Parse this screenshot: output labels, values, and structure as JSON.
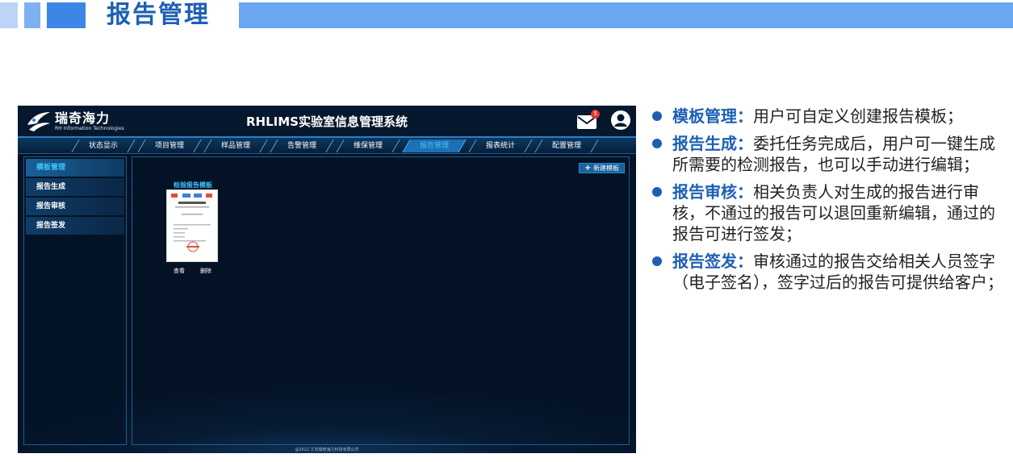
{
  "slide": {
    "title": "报告管理"
  },
  "app": {
    "logo": {
      "name_cn": "瑞奇海力",
      "name_en": "RH Information Technologies"
    },
    "title": "RHLIMS实验室信息管理系统",
    "mail_count": "5",
    "nav": [
      "状态显示",
      "项目管理",
      "样品管理",
      "告警管理",
      "维保管理",
      "报告管理",
      "报表统计",
      "配置管理"
    ],
    "nav_active": "报告管理",
    "sidebar": [
      "模板管理",
      "报告生成",
      "报告审核",
      "报告签发"
    ],
    "sidebar_active": "模板管理",
    "new_template_label": "新建模板",
    "template": {
      "title": "检验报告模板",
      "view_label": "查看",
      "delete_label": "删除"
    },
    "copyright": "@2022 江苏瑞奇海力科技有限公司"
  },
  "bullets": [
    {
      "term": "模板管理：",
      "text": "用户可自定义创建报告模板；"
    },
    {
      "term": "报告生成：",
      "text": "委托任务完成后，用户可一键生成所需要的检测报告，也可以手动进行编辑；"
    },
    {
      "term": "报告审核：",
      "text": "相关负责人对生成的报告进行审核，不通过的报告可以退回重新编辑，通过的报告可进行签发；"
    },
    {
      "term": "报告签发：",
      "text": "审核通过的报告交给相关人员签字（电子签名），签字过后的报告可提供给客户；"
    }
  ],
  "colors": {
    "accent": "#1d5fb4",
    "app_bg": "#041225",
    "active_cyan": "#3fc4ff"
  }
}
